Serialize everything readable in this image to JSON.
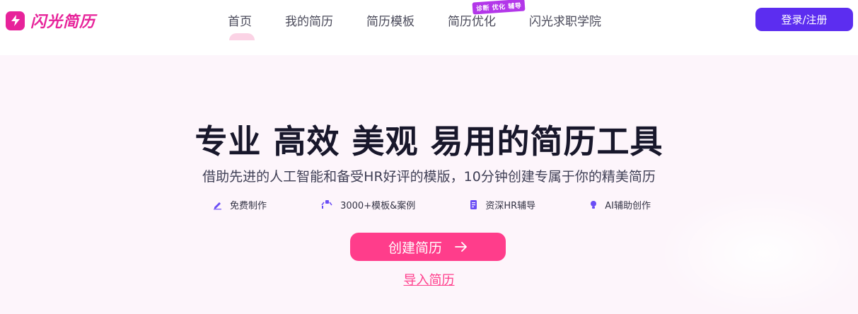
{
  "brand": {
    "name": "闪光简历",
    "color": "#e7239a",
    "icon": "lightning-bolt-icon"
  },
  "nav": {
    "items": [
      {
        "label": "首页",
        "active": true
      },
      {
        "label": "我的简历",
        "active": false
      },
      {
        "label": "简历模板",
        "active": false
      },
      {
        "label": "简历优化",
        "active": false,
        "badge": "诊断 优化 辅导"
      },
      {
        "label": "闪光求职学院",
        "active": false
      }
    ],
    "active_mark": "\" \""
  },
  "auth": {
    "login_label": "登录/注册",
    "color": "#5c2df0"
  },
  "hero": {
    "title": "专业 高效 美观 易用的简历工具",
    "subtitle": "借助先进的人工智能和备受HR好评的模版，10分钟创建专属于你的精美简历",
    "features": [
      {
        "icon": "pencil-icon",
        "label": "免费制作"
      },
      {
        "icon": "templates-icon",
        "label": "3000+模板&案例"
      },
      {
        "icon": "document-icon",
        "label": "资深HR辅导"
      },
      {
        "icon": "lightbulb-icon",
        "label": "AI辅助创作"
      }
    ],
    "create_label": "创建简历",
    "create_icon": "arrow-right-icon",
    "import_label": "导入简历",
    "accent_color": "#ff3d8b",
    "background": "#fdf5fb"
  }
}
